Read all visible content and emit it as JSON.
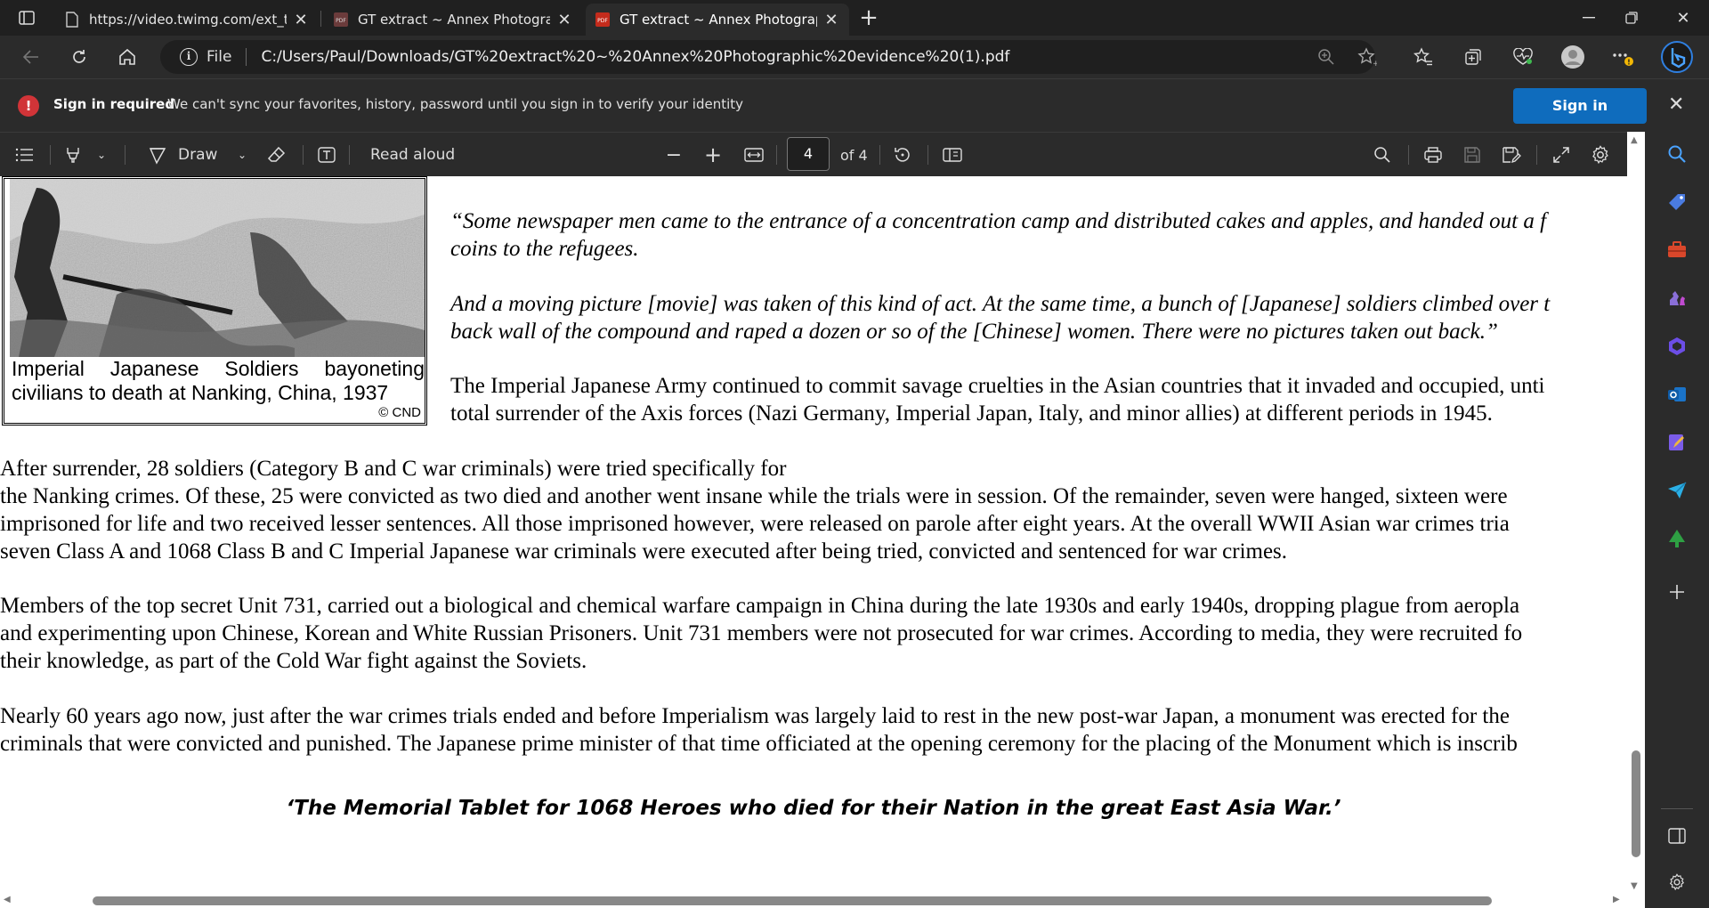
{
  "tabs": [
    {
      "title": "https://video.twimg.com/ext_tw_",
      "active": false
    },
    {
      "title": "GT extract ~ Annex Photographic",
      "active": false
    },
    {
      "title": "GT extract ~ Annex Photographic",
      "active": true
    }
  ],
  "address_bar": {
    "scheme": "File",
    "url": "C:/Users/Paul/Downloads/GT%20extract%20~%20Annex%20Photographic%20evidence%20(1).pdf"
  },
  "signin_bar": {
    "title": "Sign in required",
    "message": "We can't sync your favorites, history, password until you sign in to verify your identity",
    "button": "Sign in"
  },
  "pdf_toolbar": {
    "draw_label": "Draw",
    "read_aloud_label": "Read aloud",
    "current_page": "4",
    "page_total": "of 4"
  },
  "document": {
    "photo_caption_line1": "Imperial Japanese Soldiers bayoneting",
    "photo_caption_line2": "civilians to death at Nanking, China, 1937",
    "photo_credit": "© CND",
    "quote_lines": [
      "“Some newspaper men came to the entrance of a concentration camp and distributed cakes and apples, and handed out a f",
      "coins to the refugees.",
      "And a moving picture [movie] was taken of this kind of act. At the same time, a bunch of [Japanese] soldiers climbed over t",
      "back wall of the compound and raped a dozen or so of the [Chinese] women. There were no pictures taken out back.”"
    ],
    "para1_lines": [
      "The Imperial Japanese Army continued to commit savage cruelties in the Asian countries that it invaded and occupied, unti",
      "total surrender of the Axis forces (Nazi Germany, Imperial Japan, Italy, and minor allies) at different periods in 1945."
    ],
    "para2_lines": [
      "After surrender, 28 soldiers (Category B and C war criminals) were tried specifically for",
      "the Nanking crimes. Of these, 25 were convicted as two died and another went insane while the trials were in session. Of the remainder, seven were hanged, sixteen were",
      "imprisoned for life and two received lesser sentences. All those imprisoned however, were released on parole after eight years. At the overall WWII Asian war crimes tria",
      "seven Class A and 1068 Class B and C Imperial Japanese war criminals were executed after being tried, convicted and sentenced for war crimes."
    ],
    "para3_lines": [
      "Members of the top secret Unit 731, carried out a biological and chemical warfare campaign in China during the late 1930s and early 1940s, dropping plague from aeropla",
      "and experimenting upon Chinese, Korean and White Russian Prisoners. Unit 731 members were not prosecuted for war crimes. According to media, they were recruited fo",
      "their knowledge, as part of the Cold War fight against the Soviets."
    ],
    "para4_lines": [
      "Nearly 60 years ago now, just after the war crimes trials ended and before Imperialism was largely laid to rest in the new post-war Japan, a monument was erected for the",
      "criminals that were convicted and punished. The Japanese prime minister of that time officiated at the opening ceremony for the placing of the Monument which is inscrib"
    ],
    "monument_quote": "‘The Memorial Tablet for 1068 Heroes who died for their Nation in the great East Asia War.’"
  },
  "colors": {
    "chrome_dark": "#202020",
    "chrome": "#2b2b2b",
    "accent": "#0f6cbd",
    "error": "#d13438"
  }
}
